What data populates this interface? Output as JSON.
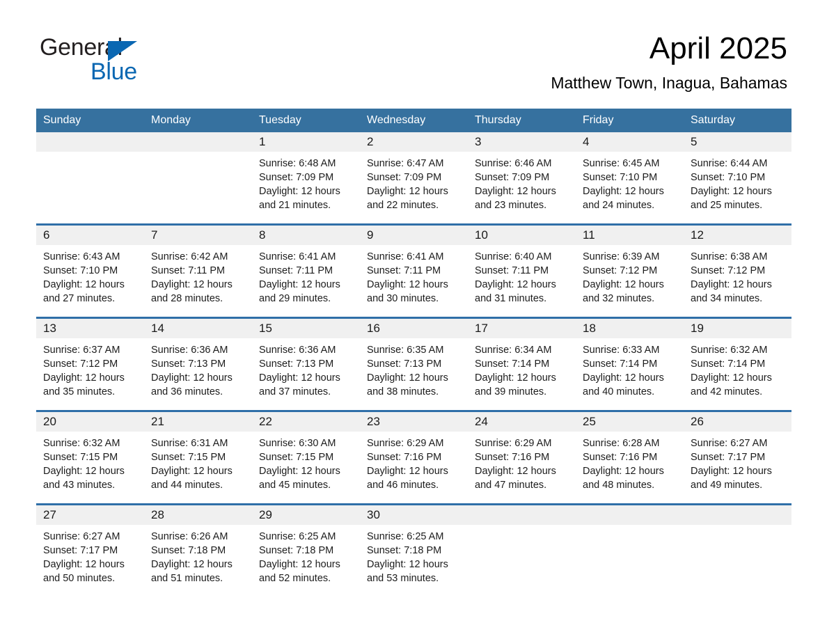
{
  "brand": {
    "name_part1": "General",
    "name_part2": "Blue",
    "color_dark": "#231f20",
    "color_blue": "#0a67b2"
  },
  "header": {
    "title": "April 2025",
    "subtitle": "Matthew Town, Inagua, Bahamas",
    "header_bg": "#36719f",
    "week_divider": "#2f6fa8",
    "daynum_bg": "#f0f0f0"
  },
  "weekday_headers": [
    "Sunday",
    "Monday",
    "Tuesday",
    "Wednesday",
    "Thursday",
    "Friday",
    "Saturday"
  ],
  "weeks": [
    [
      {
        "day": "",
        "sunrise": "",
        "sunset": "",
        "daylight1": "",
        "daylight2": ""
      },
      {
        "day": "",
        "sunrise": "",
        "sunset": "",
        "daylight1": "",
        "daylight2": ""
      },
      {
        "day": "1",
        "sunrise": "Sunrise: 6:48 AM",
        "sunset": "Sunset: 7:09 PM",
        "daylight1": "Daylight: 12 hours",
        "daylight2": "and 21 minutes."
      },
      {
        "day": "2",
        "sunrise": "Sunrise: 6:47 AM",
        "sunset": "Sunset: 7:09 PM",
        "daylight1": "Daylight: 12 hours",
        "daylight2": "and 22 minutes."
      },
      {
        "day": "3",
        "sunrise": "Sunrise: 6:46 AM",
        "sunset": "Sunset: 7:09 PM",
        "daylight1": "Daylight: 12 hours",
        "daylight2": "and 23 minutes."
      },
      {
        "day": "4",
        "sunrise": "Sunrise: 6:45 AM",
        "sunset": "Sunset: 7:10 PM",
        "daylight1": "Daylight: 12 hours",
        "daylight2": "and 24 minutes."
      },
      {
        "day": "5",
        "sunrise": "Sunrise: 6:44 AM",
        "sunset": "Sunset: 7:10 PM",
        "daylight1": "Daylight: 12 hours",
        "daylight2": "and 25 minutes."
      }
    ],
    [
      {
        "day": "6",
        "sunrise": "Sunrise: 6:43 AM",
        "sunset": "Sunset: 7:10 PM",
        "daylight1": "Daylight: 12 hours",
        "daylight2": "and 27 minutes."
      },
      {
        "day": "7",
        "sunrise": "Sunrise: 6:42 AM",
        "sunset": "Sunset: 7:11 PM",
        "daylight1": "Daylight: 12 hours",
        "daylight2": "and 28 minutes."
      },
      {
        "day": "8",
        "sunrise": "Sunrise: 6:41 AM",
        "sunset": "Sunset: 7:11 PM",
        "daylight1": "Daylight: 12 hours",
        "daylight2": "and 29 minutes."
      },
      {
        "day": "9",
        "sunrise": "Sunrise: 6:41 AM",
        "sunset": "Sunset: 7:11 PM",
        "daylight1": "Daylight: 12 hours",
        "daylight2": "and 30 minutes."
      },
      {
        "day": "10",
        "sunrise": "Sunrise: 6:40 AM",
        "sunset": "Sunset: 7:11 PM",
        "daylight1": "Daylight: 12 hours",
        "daylight2": "and 31 minutes."
      },
      {
        "day": "11",
        "sunrise": "Sunrise: 6:39 AM",
        "sunset": "Sunset: 7:12 PM",
        "daylight1": "Daylight: 12 hours",
        "daylight2": "and 32 minutes."
      },
      {
        "day": "12",
        "sunrise": "Sunrise: 6:38 AM",
        "sunset": "Sunset: 7:12 PM",
        "daylight1": "Daylight: 12 hours",
        "daylight2": "and 34 minutes."
      }
    ],
    [
      {
        "day": "13",
        "sunrise": "Sunrise: 6:37 AM",
        "sunset": "Sunset: 7:12 PM",
        "daylight1": "Daylight: 12 hours",
        "daylight2": "and 35 minutes."
      },
      {
        "day": "14",
        "sunrise": "Sunrise: 6:36 AM",
        "sunset": "Sunset: 7:13 PM",
        "daylight1": "Daylight: 12 hours",
        "daylight2": "and 36 minutes."
      },
      {
        "day": "15",
        "sunrise": "Sunrise: 6:36 AM",
        "sunset": "Sunset: 7:13 PM",
        "daylight1": "Daylight: 12 hours",
        "daylight2": "and 37 minutes."
      },
      {
        "day": "16",
        "sunrise": "Sunrise: 6:35 AM",
        "sunset": "Sunset: 7:13 PM",
        "daylight1": "Daylight: 12 hours",
        "daylight2": "and 38 minutes."
      },
      {
        "day": "17",
        "sunrise": "Sunrise: 6:34 AM",
        "sunset": "Sunset: 7:14 PM",
        "daylight1": "Daylight: 12 hours",
        "daylight2": "and 39 minutes."
      },
      {
        "day": "18",
        "sunrise": "Sunrise: 6:33 AM",
        "sunset": "Sunset: 7:14 PM",
        "daylight1": "Daylight: 12 hours",
        "daylight2": "and 40 minutes."
      },
      {
        "day": "19",
        "sunrise": "Sunrise: 6:32 AM",
        "sunset": "Sunset: 7:14 PM",
        "daylight1": "Daylight: 12 hours",
        "daylight2": "and 42 minutes."
      }
    ],
    [
      {
        "day": "20",
        "sunrise": "Sunrise: 6:32 AM",
        "sunset": "Sunset: 7:15 PM",
        "daylight1": "Daylight: 12 hours",
        "daylight2": "and 43 minutes."
      },
      {
        "day": "21",
        "sunrise": "Sunrise: 6:31 AM",
        "sunset": "Sunset: 7:15 PM",
        "daylight1": "Daylight: 12 hours",
        "daylight2": "and 44 minutes."
      },
      {
        "day": "22",
        "sunrise": "Sunrise: 6:30 AM",
        "sunset": "Sunset: 7:15 PM",
        "daylight1": "Daylight: 12 hours",
        "daylight2": "and 45 minutes."
      },
      {
        "day": "23",
        "sunrise": "Sunrise: 6:29 AM",
        "sunset": "Sunset: 7:16 PM",
        "daylight1": "Daylight: 12 hours",
        "daylight2": "and 46 minutes."
      },
      {
        "day": "24",
        "sunrise": "Sunrise: 6:29 AM",
        "sunset": "Sunset: 7:16 PM",
        "daylight1": "Daylight: 12 hours",
        "daylight2": "and 47 minutes."
      },
      {
        "day": "25",
        "sunrise": "Sunrise: 6:28 AM",
        "sunset": "Sunset: 7:16 PM",
        "daylight1": "Daylight: 12 hours",
        "daylight2": "and 48 minutes."
      },
      {
        "day": "26",
        "sunrise": "Sunrise: 6:27 AM",
        "sunset": "Sunset: 7:17 PM",
        "daylight1": "Daylight: 12 hours",
        "daylight2": "and 49 minutes."
      }
    ],
    [
      {
        "day": "27",
        "sunrise": "Sunrise: 6:27 AM",
        "sunset": "Sunset: 7:17 PM",
        "daylight1": "Daylight: 12 hours",
        "daylight2": "and 50 minutes."
      },
      {
        "day": "28",
        "sunrise": "Sunrise: 6:26 AM",
        "sunset": "Sunset: 7:18 PM",
        "daylight1": "Daylight: 12 hours",
        "daylight2": "and 51 minutes."
      },
      {
        "day": "29",
        "sunrise": "Sunrise: 6:25 AM",
        "sunset": "Sunset: 7:18 PM",
        "daylight1": "Daylight: 12 hours",
        "daylight2": "and 52 minutes."
      },
      {
        "day": "30",
        "sunrise": "Sunrise: 6:25 AM",
        "sunset": "Sunset: 7:18 PM",
        "daylight1": "Daylight: 12 hours",
        "daylight2": "and 53 minutes."
      },
      {
        "day": "",
        "sunrise": "",
        "sunset": "",
        "daylight1": "",
        "daylight2": ""
      },
      {
        "day": "",
        "sunrise": "",
        "sunset": "",
        "daylight1": "",
        "daylight2": ""
      },
      {
        "day": "",
        "sunrise": "",
        "sunset": "",
        "daylight1": "",
        "daylight2": ""
      }
    ]
  ]
}
